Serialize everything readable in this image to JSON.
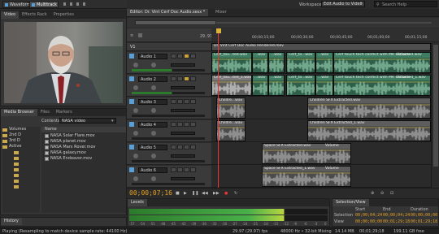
{
  "left_panel": {
    "tabs": [
      "Video",
      "Effects Rack",
      "Properties"
    ]
  },
  "mode_tabs": {
    "waveform": "Waveform",
    "multitrack": "Multitrack"
  },
  "media_browser": {
    "tabs": [
      "Media Browser",
      "Files",
      "Markers"
    ],
    "contents_label": "Contents:",
    "contents_value": "NASA video",
    "column_name": "Name",
    "tree": [
      "Volumes",
      "2nd D",
      "3rd D",
      "Active",
      "",
      "",
      "",
      "",
      "",
      "",
      ""
    ],
    "files": [
      "NASA Solar Flare.mov",
      "NASA planet.mov",
      "NASA Mars Rover.mov",
      "NASA galaxy.mov",
      "NASA Endeavor.mov"
    ]
  },
  "history": {
    "label": "History"
  },
  "editor": {
    "tab_label": "Editor: Dr. Vint Cerf Doc Audio.sesx *",
    "mixer_label": "Mixer",
    "workspace_label": "Workspace:",
    "workspace_value": "Edit Audio to Video",
    "search_placeholder": "Search Help",
    "time_ruler": [
      "29.97",
      "00;00;15;00",
      "00;00;30;00",
      "00;00;45;00",
      "00;01;00;00",
      "00;01;15;00"
    ],
    "video_track": {
      "name": "V1",
      "clip": "Dr. Vint Cerf Doc Audio Rendered.mov"
    },
    "tracks": [
      {
        "name": "Audio 1",
        "clips": [
          {
            "label": "Cerf_tou...ted.wav"
          },
          {
            "label": "...wav"
          },
          {
            "label": "...wav"
          },
          {
            "label": "Cerf_to...wav"
          },
          {
            "label": "...wav"
          },
          {
            "label": "Cerf touch tech conflict with MR Extracted.wav"
          },
          {
            "label": "Volume"
          }
        ]
      },
      {
        "name": "Audio 2",
        "clips": [
          {
            "label": "Cerf_tou...ted_1.wav"
          },
          {
            "label": "...wav"
          },
          {
            "label": "...wav"
          },
          {
            "label": "Cerf_to...wav"
          },
          {
            "label": "...wav"
          },
          {
            "label": "Cerf touch tech conflict with MR Extracted_1.wav"
          },
          {
            "label": "Volume"
          }
        ]
      },
      {
        "name": "Audio 3",
        "clips": [
          {
            "label": "Childre...wav"
          },
          {
            "label": "Children SFX Extracted.wav"
          }
        ]
      },
      {
        "name": "Audio 4",
        "clips": [
          {
            "label": "Childre...wav"
          },
          {
            "label": "Children SFX Extracted_1.wav"
          }
        ]
      },
      {
        "name": "Audio 5",
        "clips": [
          {
            "label": "Space SFX Extracted.wav"
          },
          {
            "label": "Volume"
          }
        ]
      },
      {
        "name": "Audio 6",
        "clips": [
          {
            "label": "Space SFX Extracted_1.wav"
          },
          {
            "label": "Volume"
          }
        ]
      }
    ],
    "current_time": "00;00;07;16"
  },
  "levels": {
    "label": "Levels",
    "scale": [
      "-57",
      "-54",
      "-51",
      "-48",
      "-45",
      "-42",
      "-39",
      "-36",
      "-33",
      "-30",
      "-27",
      "-24",
      "-21",
      "-18",
      "-15",
      "-12",
      "-9",
      "-6",
      "-3",
      "0"
    ]
  },
  "selection_view": {
    "label": "Selection/View",
    "col_start": "Start",
    "col_end": "End",
    "col_duration": "Duration",
    "row_selection": "Selection",
    "row_view": "View",
    "selection_start": "00;00;04;24",
    "selection_end": "00;00;04;24",
    "selection_duration": "00;00;00;00",
    "view_start": "00;00;00;00",
    "view_end": "00;01;29;18",
    "view_duration": "00;01;29;18"
  },
  "status_bar": {
    "message": "Playing (Resampling to match device sample rate: 44100 Hz)",
    "fps": "29.97 (29.97) fps",
    "format": "48000 Hz • 32-bit Mixing",
    "memory": "14.14 MB",
    "duration": "00;01;29;18",
    "free": "199.11 GB free"
  }
}
